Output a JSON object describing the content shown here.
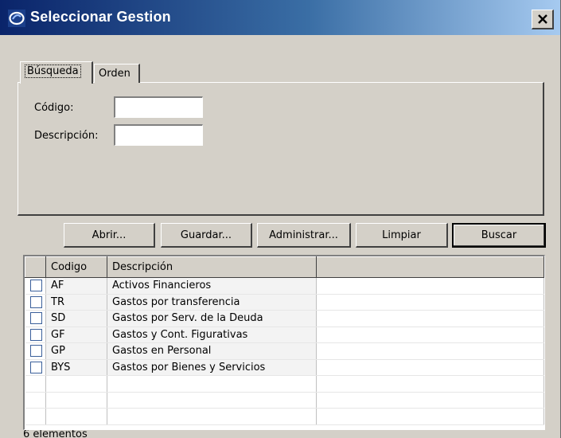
{
  "window": {
    "title": "Seleccionar Gestion",
    "close_label": "×"
  },
  "tabs": [
    {
      "label": "Búsqueda",
      "active": true
    },
    {
      "label": "Orden",
      "active": false
    }
  ],
  "search": {
    "codigo_label": "Código:",
    "codigo_value": "",
    "descripcion_label": "Descripción:",
    "descripcion_value": ""
  },
  "buttons": {
    "abrir": "Abrir...",
    "guardar": "Guardar...",
    "administrar": "Administrar...",
    "limpiar": "Limpiar",
    "buscar": "Buscar"
  },
  "table": {
    "columns": [
      "",
      "Codigo",
      "Descripción",
      ""
    ],
    "rows": [
      {
        "codigo": "AF",
        "descripcion": "Activos Financieros"
      },
      {
        "codigo": "TR",
        "descripcion": "Gastos por transferencia"
      },
      {
        "codigo": "SD",
        "descripcion": "Gastos por Serv. de la Deuda"
      },
      {
        "codigo": "GF",
        "descripcion": "Gastos y Cont. Figurativas"
      },
      {
        "codigo": "GP",
        "descripcion": "Gastos en Personal"
      },
      {
        "codigo": "BYS",
        "descripcion": "Gastos por Bienes y Servicios"
      }
    ]
  },
  "status": {
    "count_text": "6 elementos"
  }
}
